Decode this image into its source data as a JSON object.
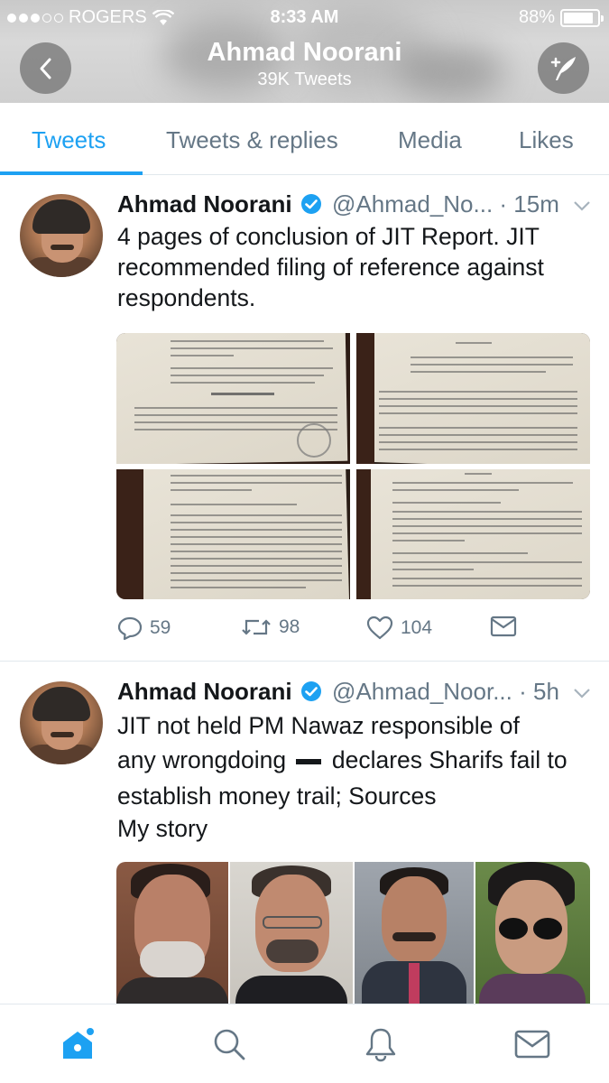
{
  "status_bar": {
    "carrier": "ROGERS",
    "time": "8:33 AM",
    "battery": "88%",
    "battery_level": 0.88
  },
  "header": {
    "name": "Ahmad Noorani",
    "tweet_count": "39K Tweets",
    "back_icon": "back-arrow-icon",
    "compose_icon": "compose-tweet-icon"
  },
  "tabs": [
    {
      "label": "Tweets",
      "active": true
    },
    {
      "label": "Tweets & replies",
      "active": false
    },
    {
      "label": "Media",
      "active": false
    },
    {
      "label": "Likes",
      "active": false
    }
  ],
  "tweets": [
    {
      "name": "Ahmad Noorani",
      "handle": "@Ahmad_No...",
      "time": "· 15m",
      "text": "4 pages of conclusion of JIT Report. JIT recommended filing of reference against respondents.",
      "media": "4 document photos",
      "replies": "59",
      "retweets": "98",
      "likes": "104"
    },
    {
      "name": "Ahmad Noorani",
      "handle": "@Ahmad_Noor...",
      "time": "· 5h",
      "text_line1": "JIT not held PM Nawaz responsible of",
      "text_line2a": "any wrongdoing",
      "text_line2b": "declares Sharifs fail to",
      "text_line3": "establish money trail; Sources",
      "text_line4": "My story",
      "media": "4 portrait photos"
    }
  ],
  "bottom_nav": [
    {
      "icon": "home-icon",
      "active": true
    },
    {
      "icon": "search-icon",
      "active": false
    },
    {
      "icon": "notifications-bell-icon",
      "active": false
    },
    {
      "icon": "messages-envelope-icon",
      "active": false
    }
  ],
  "colors": {
    "accent": "#1da1f2",
    "muted": "#657786",
    "text": "#14171a"
  }
}
